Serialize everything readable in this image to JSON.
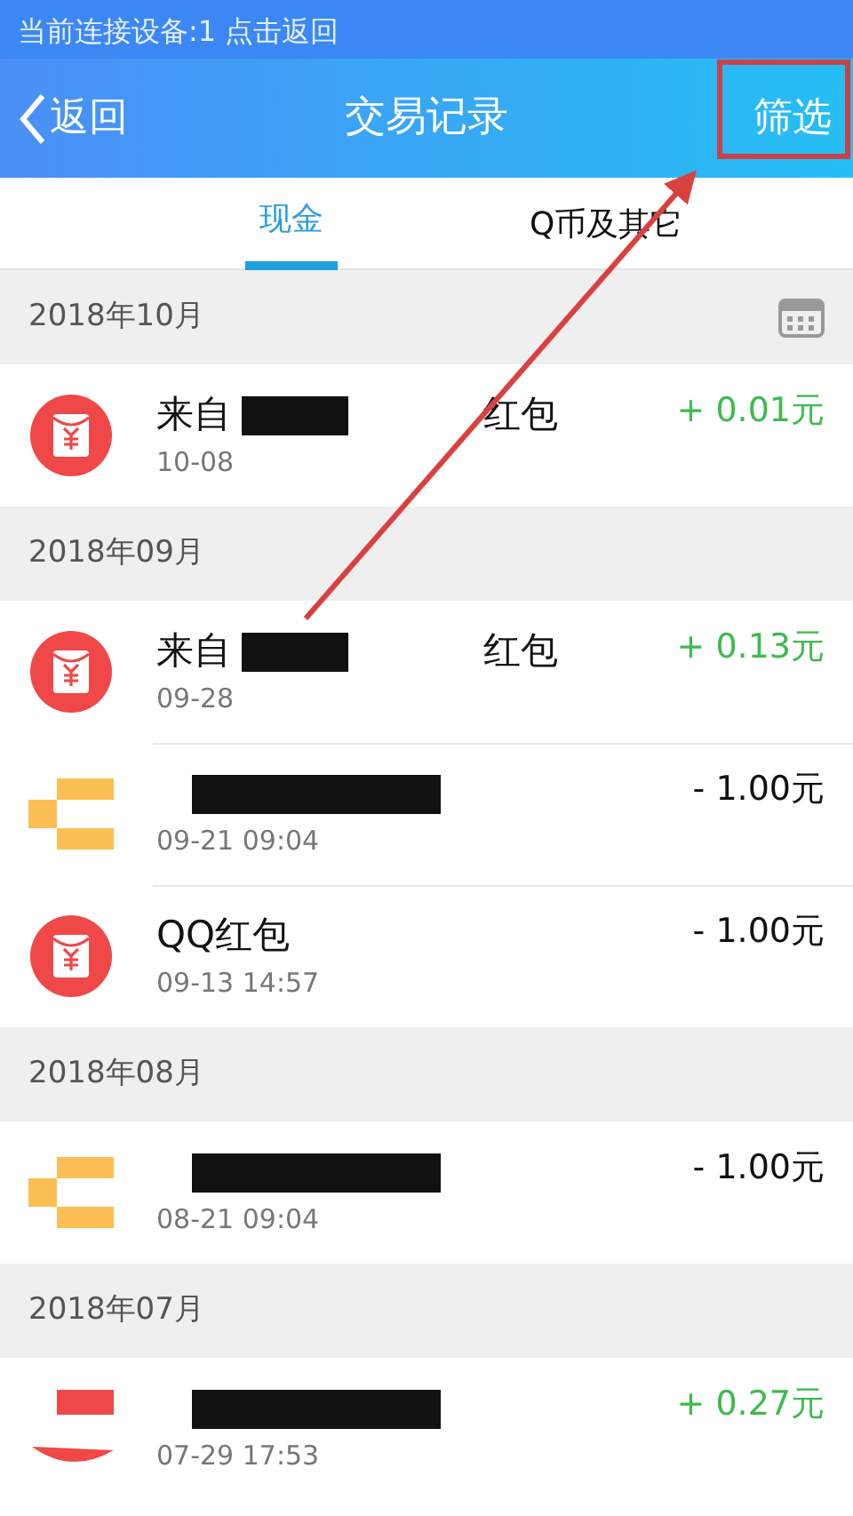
{
  "status_bar": {
    "text": "当前连接设备:1 点击返回"
  },
  "header": {
    "back": "返回",
    "title": "交易记录",
    "action": "筛选"
  },
  "tabs": [
    {
      "label": "现金",
      "selected": true
    },
    {
      "label": "Q币及其它",
      "selected": false
    }
  ],
  "sections": [
    {
      "month": "2018年10月",
      "calendar": true,
      "rows": [
        {
          "kind": "envelope",
          "title_start": "来自",
          "title_end": "红包",
          "redacted": true,
          "time": "10-08",
          "amount": "+ 0.01元",
          "income": true
        }
      ]
    },
    {
      "month": "2018年09月",
      "calendar": false,
      "rows": [
        {
          "kind": "envelope",
          "title_start": "来自",
          "title_end": "红包",
          "redacted": true,
          "time": "09-28",
          "amount": "+ 0.13元",
          "income": true
        },
        {
          "kind": "blocks",
          "redacted": true,
          "time": "09-21 09:04",
          "amount": "- 1.00元",
          "income": false
        },
        {
          "kind": "envelope",
          "title_start": "QQ红包",
          "redacted": false,
          "time": "09-13 14:57",
          "amount": "- 1.00元",
          "income": false
        }
      ]
    },
    {
      "month": "2018年08月",
      "calendar": false,
      "rows": [
        {
          "kind": "blocks",
          "redacted": true,
          "time": "08-21 09:04",
          "amount": "- 1.00元",
          "income": false
        }
      ]
    },
    {
      "month": "2018年07月",
      "calendar": false,
      "rows": [
        {
          "kind": "shapes",
          "redacted": true,
          "time": "07-29 17:53",
          "amount": "+ 0.27元",
          "income": true
        }
      ]
    }
  ],
  "annotations": {
    "frame": true,
    "arrow": true
  }
}
